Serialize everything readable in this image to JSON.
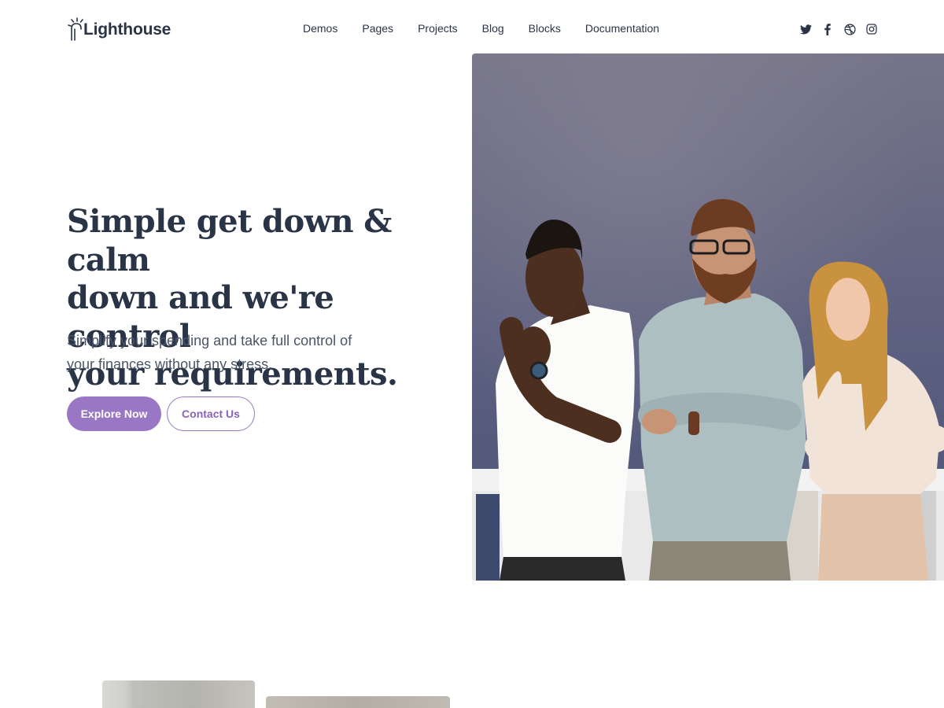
{
  "brand": {
    "name": "Lighthouse",
    "accent": "#9a77c4",
    "text_color": "#2a3447"
  },
  "nav": {
    "items": [
      {
        "label": "Demos"
      },
      {
        "label": "Pages"
      },
      {
        "label": "Projects"
      },
      {
        "label": "Blog"
      },
      {
        "label": "Blocks"
      },
      {
        "label": "Documentation"
      }
    ]
  },
  "social": {
    "icons": [
      "twitter-icon",
      "facebook-icon",
      "dribbble-icon",
      "instagram-icon"
    ]
  },
  "hero": {
    "title_lines": [
      "Simple get down & calm",
      "down and we're control",
      "your requirements."
    ],
    "subtitle_lines": [
      "Simplify your spending and take full control of",
      "your finances without any stress."
    ],
    "primary_button": "Explore Now",
    "secondary_button": "Contact Us"
  }
}
